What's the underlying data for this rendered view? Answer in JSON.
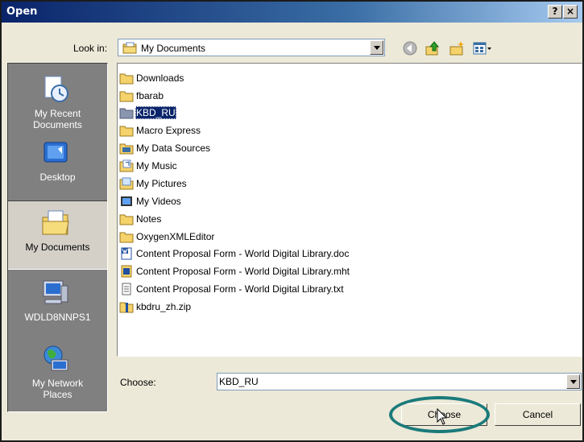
{
  "window": {
    "title": "Open",
    "help_glyph": "?",
    "close_glyph": "×"
  },
  "lookin": {
    "label": "Look in:",
    "value": "My Documents"
  },
  "toolbar": {
    "icons": [
      "back-icon",
      "up-folder-icon",
      "new-folder-icon",
      "view-menu-icon"
    ]
  },
  "places": [
    {
      "label1": "My Recent",
      "label2": "Documents",
      "icon": "recent-documents-icon"
    },
    {
      "label1": "Desktop",
      "label2": "",
      "icon": "desktop-icon"
    },
    {
      "label1": "My Documents",
      "label2": "",
      "icon": "my-documents-icon"
    },
    {
      "label1": "WDLD8NNPS1",
      "label2": "",
      "icon": "my-computer-icon"
    },
    {
      "label1": "My Network",
      "label2": "Places",
      "icon": "network-places-icon"
    }
  ],
  "files": [
    {
      "name": "Downloads",
      "type": "folder"
    },
    {
      "name": "fbarab",
      "type": "folder"
    },
    {
      "name": "KBD_RU",
      "type": "folder-grey",
      "selected": true
    },
    {
      "name": "Macro Express",
      "type": "folder"
    },
    {
      "name": "My Data Sources",
      "type": "datasource"
    },
    {
      "name": "My Music",
      "type": "music"
    },
    {
      "name": "My Pictures",
      "type": "pictures"
    },
    {
      "name": "My Videos",
      "type": "videos"
    },
    {
      "name": "Notes",
      "type": "folder"
    },
    {
      "name": "OxygenXMLEditor",
      "type": "folder"
    },
    {
      "name": "Content Proposal Form - World Digital Library.doc",
      "type": "doc"
    },
    {
      "name": "Content Proposal Form - World Digital Library.mht",
      "type": "mht"
    },
    {
      "name": "Content Proposal Form - World Digital Library.txt",
      "type": "txt"
    },
    {
      "name": "kbdru_zh.zip",
      "type": "zip"
    }
  ],
  "choose": {
    "label": "Choose:",
    "value": "KBD_RU"
  },
  "buttons": {
    "choose": "Choose",
    "cancel": "Cancel"
  },
  "colors": {
    "highlight_oval": "#1a7a7a",
    "selection": "#0a246a",
    "folder": "#f5d26a"
  }
}
